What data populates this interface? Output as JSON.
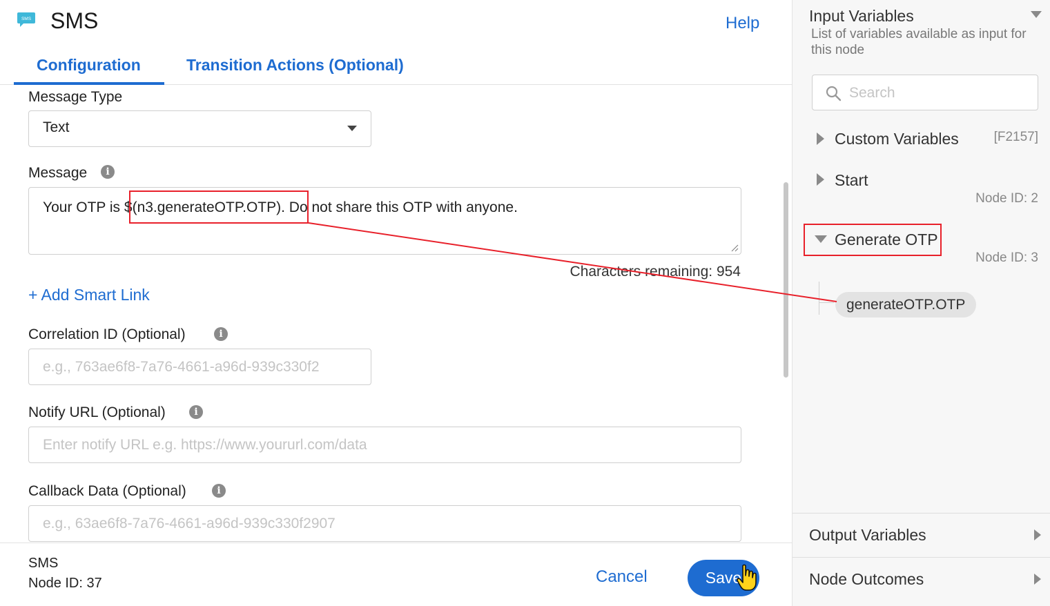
{
  "header": {
    "icon": "sms-chat-bubble-icon",
    "icon_text": "SMS",
    "title": "SMS",
    "help": "Help",
    "tabs": [
      {
        "label": "Configuration",
        "active": true
      },
      {
        "label": "Transition Actions (Optional)",
        "active": false
      }
    ]
  },
  "form": {
    "message_type": {
      "label": "Message Type",
      "value": "Text"
    },
    "message": {
      "label": "Message",
      "prefix": "Your OTP is ",
      "variable": "$(n3.generateOTP.OTP)",
      "suffix": ". Do not share this OTP with anyone.",
      "chars_remaining": "Characters remaining: 954"
    },
    "add_smart_link": "+ Add Smart Link",
    "correlation_id": {
      "label": "Correlation ID (Optional)",
      "placeholder": "e.g., 763ae6f8-7a76-4661-a96d-939c330f2"
    },
    "notify_url": {
      "label": "Notify URL (Optional)",
      "placeholder": "Enter notify URL e.g. https://www.yoururl.com/data"
    },
    "callback_data": {
      "label": "Callback Data (Optional)",
      "placeholder": "e.g., 63ae6f8-7a76-4661-a96d-939c330f2907"
    }
  },
  "footer": {
    "node_name": "SMS",
    "node_id": "Node ID: 37",
    "cancel": "Cancel",
    "save": "Save"
  },
  "sidebar": {
    "title": "Input Variables",
    "description": "List of variables available as input for this node",
    "search_placeholder": "Search",
    "tree": [
      {
        "label": "Custom Variables",
        "meta": "[F2157]",
        "expanded": false
      },
      {
        "label": "Start",
        "meta": "Node ID: 2",
        "expanded": false
      },
      {
        "label": "Generate OTP",
        "meta": "Node ID: 3",
        "expanded": true,
        "children": [
          "generateOTP.OTP"
        ]
      }
    ],
    "sections": [
      {
        "label": "Output Variables"
      },
      {
        "label": "Node Outcomes"
      }
    ]
  },
  "colors": {
    "accent": "#1e6cd1",
    "annotation": "#e8202a"
  }
}
